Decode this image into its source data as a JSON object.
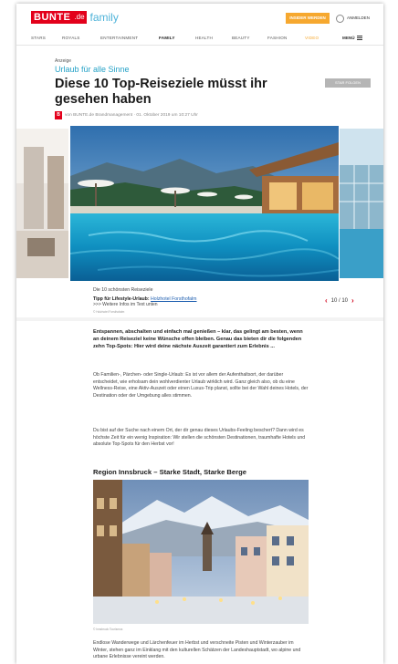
{
  "header": {
    "logo_main": "BUNTE",
    "logo_de": ".de",
    "logo_section": "family",
    "insider_button": "INSIDER WERDEN",
    "login_label": "ANMELDEN"
  },
  "nav": {
    "items": [
      "STARS",
      "ROYALS",
      "ENTERTAINMENT",
      "FAMILY",
      "HEALTH",
      "BEAUTY",
      "FASHION",
      "VIDEO"
    ],
    "menu_label": "MENÜ"
  },
  "article": {
    "anzeige": "Anzeige",
    "kicker": "Urlaub für alle Sinne",
    "headline": "Diese 10 Top-Reiseziele müsst ihr gesehen haben",
    "follow_button": "STAR FOLGEN",
    "byline": "von BUNTE.de Brandmanagement · 01. Oktober 2019 um 10:27 Uhr",
    "byline_badge": "B"
  },
  "gallery": {
    "caption_title": "Die 10 schönsten Reiseziele",
    "tipp_label": "Tipp für Lifestyle-Urlaub:",
    "tipp_link": "Holzhotel Forsthofalm",
    "more_text": ">>> Weitere Infos im Text unten",
    "credit": "© Holzhotel Forsthofalm",
    "pager": "10 / 10"
  },
  "body": {
    "intro": "Entspannen, abschalten und einfach mal genießen – klar, das gelingt am besten, wenn an deinem Reiseziel keine Wünsche offen bleiben. Genau das bieten dir die folgenden zehn Top-Spots: Hier wird deine nächste Auszeit garantiert zum Erlebnis ...",
    "para1": "Ob Familien-, Pärchen- oder Single-Urlaub: Es ist vor allem der Aufenthaltsort, der darüber entscheidet, wie erholsam dein wohlverdienter Urlaub wirklich wird. Ganz gleich also, ob du eine Wellness-Reise, eine Aktiv-Auszeit oder einen Luxus-Trip planst, sollte bei der Wahl deines Hotels, der Destination oder der Umgebung alles stimmen.",
    "para2": "Du bist auf der Suche nach einem Ort, der dir genau dieses Urlaubs-Feeling beschert? Dann wird es höchste Zeit für ein wenig Inspiration: Wir stellen die schönsten Destinationen, traumhafte Hotels und absolute Top-Spots für den Herbst vor!",
    "section_heading": "Region Innsbruck – Starke Stadt, Starke Berge",
    "image_credit": "© Innsbruck Tourismus",
    "para3": "Endlose Wanderwege und Lärchenfeuer im Herbst und verschneite Pisten und Winterzauber im Winter, stehen ganz im Einklang mit den kulturellen Schätzen der Landeshauptstadt, wo alpine und urbane Erlebnisse vereint werden."
  },
  "colors": {
    "brand_red": "#e3001b",
    "family_blue": "#4fb3d9",
    "kicker_blue": "#26a2c7",
    "insider_orange": "#f6a82f"
  }
}
